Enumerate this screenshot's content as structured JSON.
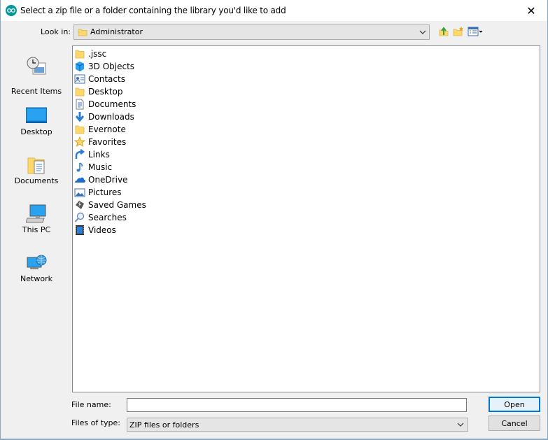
{
  "window": {
    "title": "Select a zip file or a folder containing the library you'd like to add",
    "close_glyph": "✕"
  },
  "toolbar": {
    "lookin_label": "Look in:",
    "lookin_value": "Administrator",
    "icons": [
      "up-one-level-icon",
      "new-folder-icon",
      "view-menu-icon"
    ]
  },
  "places": [
    {
      "label": "Recent Items",
      "icon": "recent-items-icon"
    },
    {
      "label": "Desktop",
      "icon": "desktop-icon"
    },
    {
      "label": "Documents",
      "icon": "documents-icon"
    },
    {
      "label": "This PC",
      "icon": "this-pc-icon"
    },
    {
      "label": "Network",
      "icon": "network-icon"
    }
  ],
  "files": [
    {
      "name": ".jssc",
      "icon": "folder"
    },
    {
      "name": "3D Objects",
      "icon": "3d-objects"
    },
    {
      "name": "Contacts",
      "icon": "contacts"
    },
    {
      "name": "Desktop",
      "icon": "folder"
    },
    {
      "name": "Documents",
      "icon": "documents"
    },
    {
      "name": "Downloads",
      "icon": "downloads"
    },
    {
      "name": "Evernote",
      "icon": "folder"
    },
    {
      "name": "Favorites",
      "icon": "favorites"
    },
    {
      "name": "Links",
      "icon": "links"
    },
    {
      "name": "Music",
      "icon": "music"
    },
    {
      "name": "OneDrive",
      "icon": "onedrive"
    },
    {
      "name": "Pictures",
      "icon": "pictures"
    },
    {
      "name": "Saved Games",
      "icon": "saved-games"
    },
    {
      "name": "Searches",
      "icon": "searches"
    },
    {
      "name": "Videos",
      "icon": "videos"
    }
  ],
  "footer": {
    "filename_label": "File name:",
    "filename_value": "",
    "filetype_label": "Files of type:",
    "filetype_value": "ZIP files or folders",
    "open_label": "Open",
    "cancel_label": "Cancel"
  },
  "colors": {
    "accent": "#0078d7",
    "folder": "#ffd86b",
    "app_icon": "#00979c"
  }
}
